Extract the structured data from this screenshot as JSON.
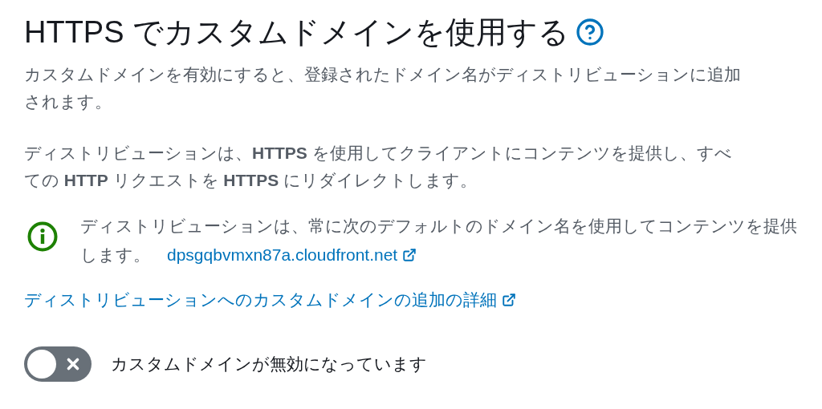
{
  "heading": {
    "title": "HTTPS でカスタムドメインを使用する"
  },
  "paragraphs": [
    "カスタムドメインを有効にすると、登録されたドメイン名がディストリビューションに追加されます。",
    "ディストリビューションは、**HTTPS** を使用してクライアントにコンテンツを提供し、すべての **HTTP** リクエストを **HTTPS** にリダイレクトします。"
  ],
  "info": {
    "text": "ディストリビューションは、常に次のデフォルトのドメイン名を使用してコンテンツを提供します。",
    "link": "dpsgqbvmxn87a.cloudfront.net"
  },
  "details_link": "ディストリビューションへのカスタムドメインの追加の詳細",
  "toggle": {
    "label": "カスタムドメインが無効になっています",
    "on": false
  }
}
